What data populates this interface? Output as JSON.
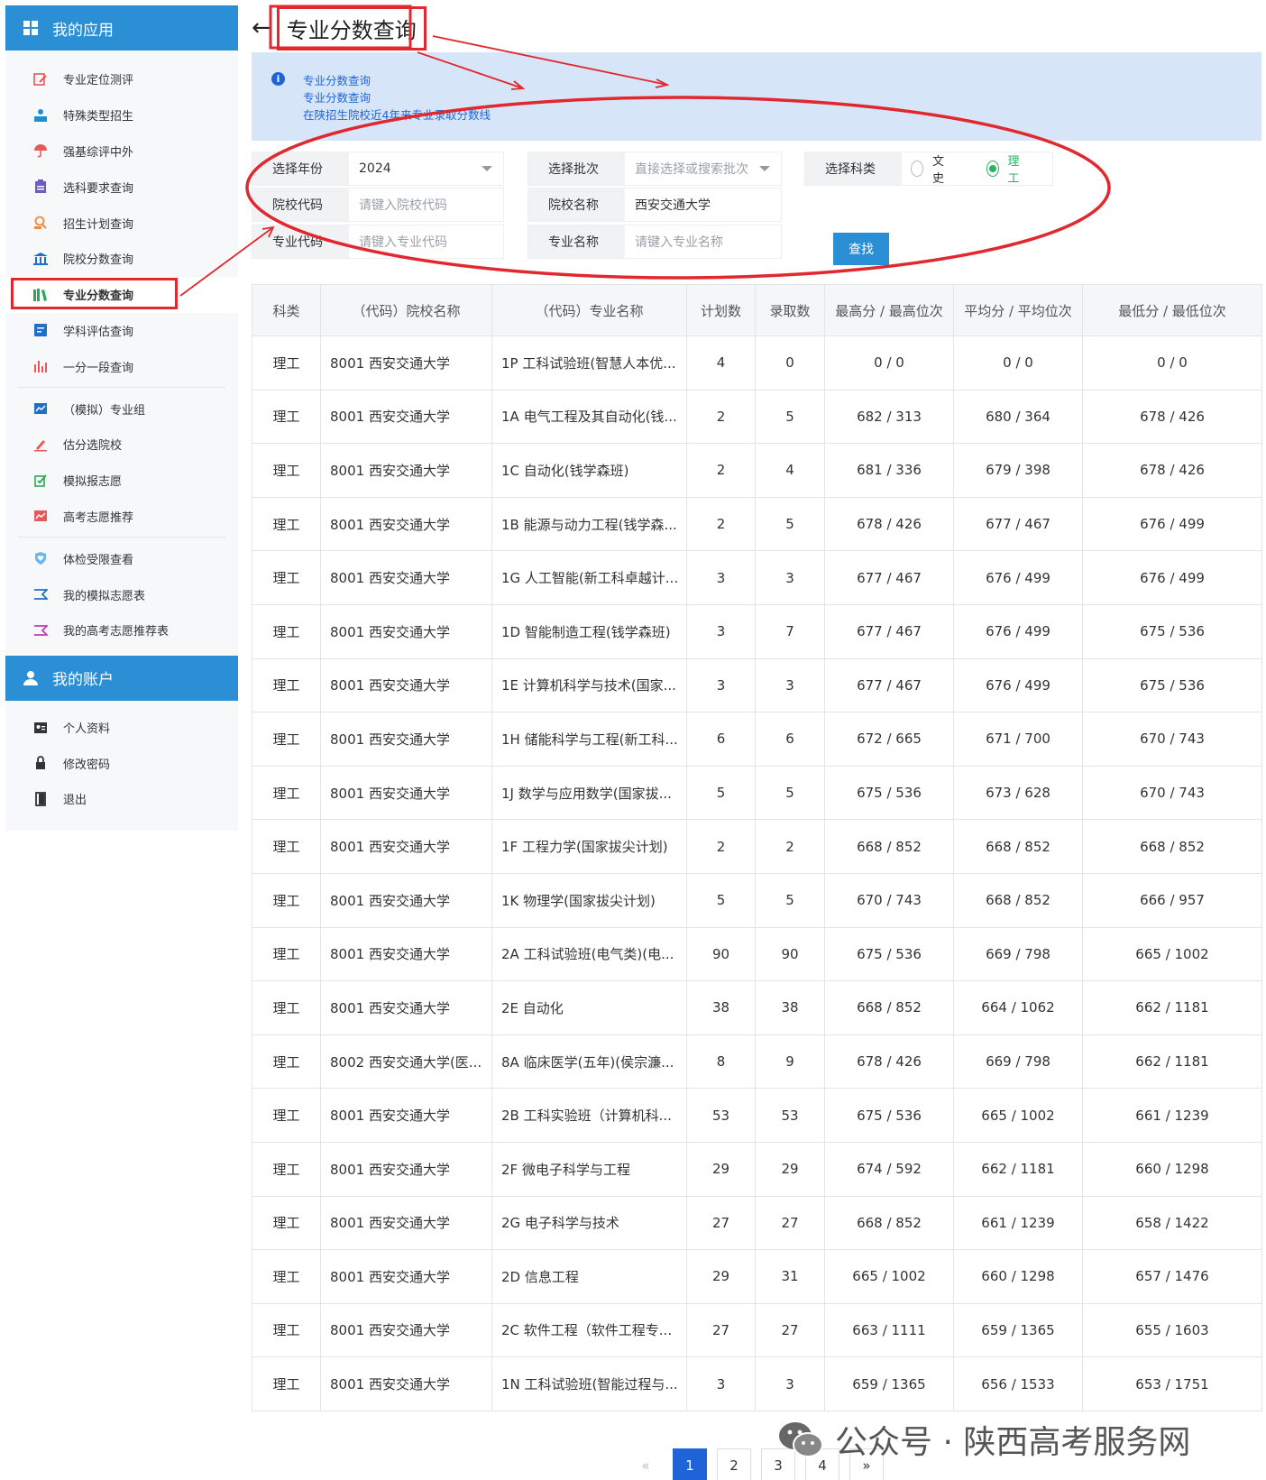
{
  "sidebar": {
    "apps_header": "我的应用",
    "items": [
      {
        "label": "专业定位测评"
      },
      {
        "label": "特殊类型招生"
      },
      {
        "label": "强基综评中外"
      },
      {
        "label": "选科要求查询"
      },
      {
        "label": "招生计划查询"
      },
      {
        "label": "院校分数查询"
      },
      {
        "label": "专业分数查询"
      },
      {
        "label": "学科评估查询"
      },
      {
        "label": "一分一段查询"
      },
      {
        "label": "（模拟）专业组"
      },
      {
        "label": "估分选院校"
      },
      {
        "label": "模拟报志愿"
      },
      {
        "label": "高考志愿推荐"
      },
      {
        "label": "体检受限查看"
      },
      {
        "label": "我的模拟志愿表"
      },
      {
        "label": "我的高考志愿推荐表"
      }
    ],
    "account_header": "我的账户",
    "account_items": [
      {
        "label": "个人资料"
      },
      {
        "label": "修改密码"
      },
      {
        "label": "退出"
      }
    ]
  },
  "page": {
    "back": "←",
    "title": "专业分数查询",
    "info_icon": "i",
    "info_lines": [
      "专业分数查询",
      "专业分数查询",
      "在陕招生院校近4年来专业录取分数线"
    ]
  },
  "form": {
    "year_label": "选择年份",
    "year_value": "2024",
    "batch_label": "选择批次",
    "batch_placeholder": "直接选择或搜索批次",
    "category_label": "选择科类",
    "category_options": [
      "文史",
      "理工"
    ],
    "school_code_label": "院校代码",
    "school_code_placeholder": "请键入院校代码",
    "school_name_label": "院校名称",
    "school_name_value": "西安交通大学",
    "major_code_label": "专业代码",
    "major_code_placeholder": "请键入专业代码",
    "major_name_label": "专业名称",
    "major_name_placeholder": "请键入专业名称",
    "search_button": "查找"
  },
  "table": {
    "headers": [
      "科类",
      "（代码）院校名称",
      "（代码）专业名称",
      "计划数",
      "录取数",
      "最高分 / 最高位次",
      "平均分 / 平均位次",
      "最低分 / 最低位次"
    ],
    "rows": [
      [
        "理工",
        "8001 西安交通大学",
        "1P 工科试验班(智慧人本优...",
        "4",
        "0",
        "0 / 0",
        "0 / 0",
        "0 / 0"
      ],
      [
        "理工",
        "8001 西安交通大学",
        "1A 电气工程及其自动化(钱...",
        "2",
        "5",
        "682 / 313",
        "680 / 364",
        "678 / 426"
      ],
      [
        "理工",
        "8001 西安交通大学",
        "1C 自动化(钱学森班)",
        "2",
        "4",
        "681 / 336",
        "679 / 398",
        "678 / 426"
      ],
      [
        "理工",
        "8001 西安交通大学",
        "1B 能源与动力工程(钱学森...",
        "2",
        "5",
        "678 / 426",
        "677 / 467",
        "676 / 499"
      ],
      [
        "理工",
        "8001 西安交通大学",
        "1G 人工智能(新工科卓越计...",
        "3",
        "3",
        "677 / 467",
        "676 / 499",
        "676 / 499"
      ],
      [
        "理工",
        "8001 西安交通大学",
        "1D 智能制造工程(钱学森班)",
        "3",
        "7",
        "677 / 467",
        "676 / 499",
        "675 / 536"
      ],
      [
        "理工",
        "8001 西安交通大学",
        "1E 计算机科学与技术(国家...",
        "3",
        "3",
        "677 / 467",
        "676 / 499",
        "675 / 536"
      ],
      [
        "理工",
        "8001 西安交通大学",
        "1H 储能科学与工程(新工科...",
        "6",
        "6",
        "672 / 665",
        "671 / 700",
        "670 / 743"
      ],
      [
        "理工",
        "8001 西安交通大学",
        "1J 数学与应用数学(国家拔...",
        "5",
        "5",
        "675 / 536",
        "673 / 628",
        "670 / 743"
      ],
      [
        "理工",
        "8001 西安交通大学",
        "1F 工程力学(国家拔尖计划)",
        "2",
        "2",
        "668 / 852",
        "668 / 852",
        "668 / 852"
      ],
      [
        "理工",
        "8001 西安交通大学",
        "1K 物理学(国家拔尖计划)",
        "5",
        "5",
        "670 / 743",
        "668 / 852",
        "666 / 957"
      ],
      [
        "理工",
        "8001 西安交通大学",
        "2A 工科试验班(电气类)(电...",
        "90",
        "90",
        "675 / 536",
        "669 / 798",
        "665 / 1002"
      ],
      [
        "理工",
        "8001 西安交通大学",
        "2E 自动化",
        "38",
        "38",
        "668 / 852",
        "664 / 1062",
        "662 / 1181"
      ],
      [
        "理工",
        "8002 西安交通大学(医...",
        "8A 临床医学(五年)(侯宗濂...",
        "8",
        "9",
        "678 / 426",
        "669 / 798",
        "662 / 1181"
      ],
      [
        "理工",
        "8001 西安交通大学",
        "2B 工科实验班（计算机科...",
        "53",
        "53",
        "675 / 536",
        "665 / 1002",
        "661 / 1239"
      ],
      [
        "理工",
        "8001 西安交通大学",
        "2F 微电子科学与工程",
        "29",
        "29",
        "674 / 592",
        "662 / 1181",
        "660 / 1298"
      ],
      [
        "理工",
        "8001 西安交通大学",
        "2G 电子科学与技术",
        "27",
        "27",
        "668 / 852",
        "661 / 1239",
        "658 / 1422"
      ],
      [
        "理工",
        "8001 西安交通大学",
        "2D 信息工程",
        "29",
        "31",
        "665 / 1002",
        "660 / 1298",
        "657 / 1476"
      ],
      [
        "理工",
        "8001 西安交通大学",
        "2C 软件工程（软件工程专...",
        "27",
        "27",
        "663 / 1111",
        "659 / 1365",
        "655 / 1603"
      ],
      [
        "理工",
        "8001 西安交通大学",
        "1N 工科试验班(智能过程与...",
        "3",
        "3",
        "659 / 1365",
        "656 / 1533",
        "653 / 1751"
      ]
    ]
  },
  "pagination": {
    "prev": "«",
    "pages": [
      "1",
      "2",
      "3",
      "4"
    ],
    "current": "1",
    "next": "»"
  },
  "watermark": {
    "text": "公众号 · 陕西高考服务网"
  },
  "colors": {
    "primary": "#2b8fd6",
    "info_bg": "#d6e6f8",
    "info_text": "#1e64d8",
    "annotation_red": "#e0282e",
    "radio_green": "#28b463"
  }
}
